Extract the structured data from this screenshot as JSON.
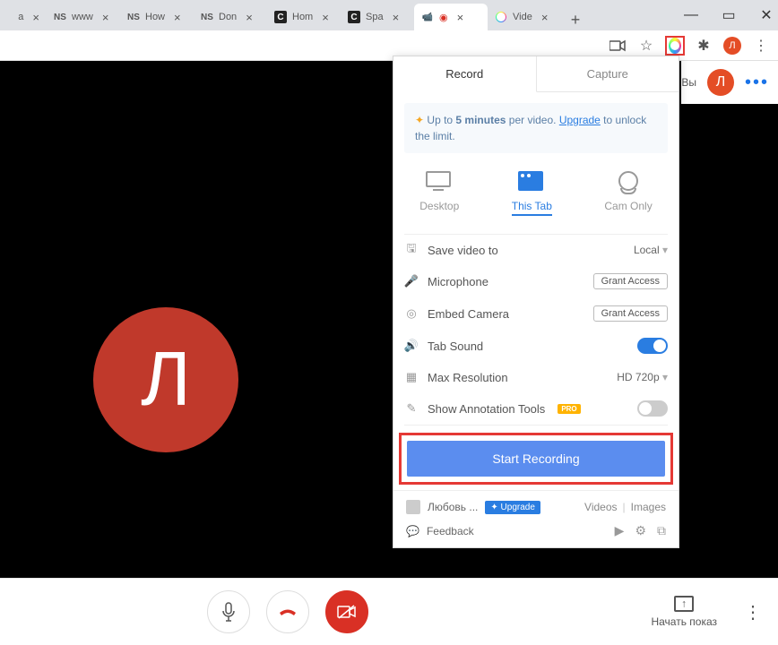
{
  "browser": {
    "tabs": [
      {
        "fav": "",
        "label": "a"
      },
      {
        "fav": "NS",
        "label": "www"
      },
      {
        "fav": "NS",
        "label": "How"
      },
      {
        "fav": "NS",
        "label": "Don"
      },
      {
        "fav": "C",
        "label": "Hom"
      },
      {
        "fav": "C",
        "label": "Spa"
      },
      {
        "fav": "●",
        "label": ""
      },
      {
        "fav": "◎",
        "label": "Vide"
      }
    ],
    "active_tab_index": 6,
    "window_controls": {
      "min": "—",
      "max": "▭",
      "close": "✕"
    }
  },
  "toolbar": {
    "icons": {
      "camera": "camera-icon",
      "star": "star-icon",
      "extension": "screencast-extension-icon",
      "puzzle": "extensions-icon",
      "profile_letter": "Л",
      "menu": "⋮"
    }
  },
  "meet_bar": {
    "vy": "Вы",
    "avatar": "Л"
  },
  "video": {
    "avatar_letter": "Л"
  },
  "popup": {
    "tabs": {
      "record": "Record",
      "capture": "Capture"
    },
    "notice_pre": "Up to ",
    "notice_bold": "5 minutes",
    "notice_mid": " per video. ",
    "notice_link": "Upgrade",
    "notice_post": " to unlock the limit.",
    "modes": {
      "desktop": "Desktop",
      "thistab": "This Tab",
      "camonly": "Cam Only"
    },
    "settings": {
      "save_video": "Save video to",
      "save_video_val": "Local",
      "microphone": "Microphone",
      "microphone_btn": "Grant Access",
      "embed_cam": "Embed Camera",
      "embed_cam_btn": "Grant Access",
      "tab_sound": "Tab Sound",
      "max_res": "Max Resolution",
      "max_res_val": "HD 720p",
      "annot": "Show Annotation Tools",
      "pro": "PRO"
    },
    "start": "Start Recording",
    "footer": {
      "user": "Любовь ...",
      "upgrade": "✦ Upgrade",
      "videos": "Videos",
      "images": "Images",
      "feedback": "Feedback"
    }
  },
  "bottom": {
    "present": "Начать показ"
  }
}
